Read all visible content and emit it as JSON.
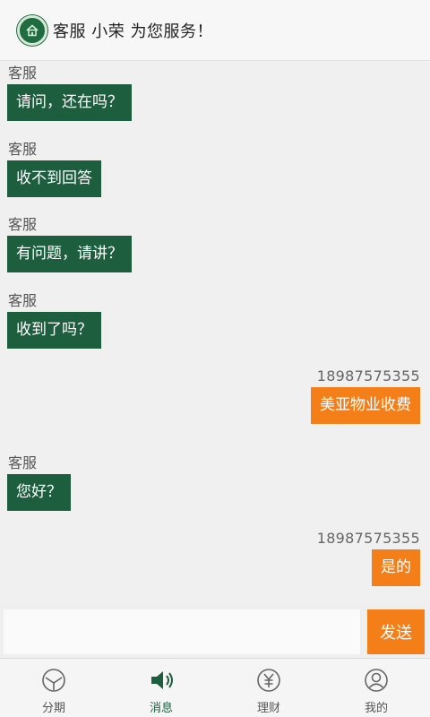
{
  "header": {
    "title": "客服 小荣 为您服务！"
  },
  "messages": [
    {
      "sender": "客服",
      "text": "请问，还在吗？"
    },
    {
      "sender": "客服",
      "text": "收不到回答"
    },
    {
      "sender": "客服",
      "text": "有问题，请讲？"
    },
    {
      "sender": "客服",
      "text": "收到了吗？"
    },
    {
      "sender": "18987575355",
      "text": "美亚物业收费"
    },
    {
      "sender": "客服",
      "text": "您好？"
    },
    {
      "sender": "18987575355",
      "text": "是的"
    }
  ],
  "composer": {
    "input_value": "",
    "send_label": "发送"
  },
  "tabs": [
    {
      "label": "分期",
      "icon": "installment-icon"
    },
    {
      "label": "消息",
      "icon": "speaker-icon",
      "active": true
    },
    {
      "label": "理财",
      "icon": "yuan-icon"
    },
    {
      "label": "我的",
      "icon": "user-icon"
    }
  ],
  "colors": {
    "brand_green": "#1d5e3f",
    "accent_orange": "#f47f19"
  }
}
